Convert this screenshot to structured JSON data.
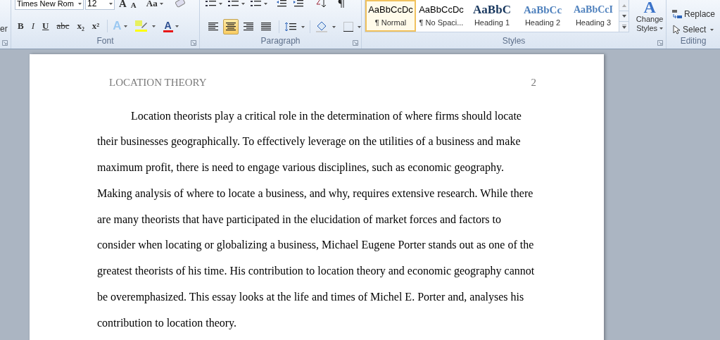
{
  "clipboard": {
    "label_fragment": "er"
  },
  "font": {
    "name": "Times New Rom",
    "size": "12",
    "format_buttons": [
      "B",
      "I",
      "U",
      "abc",
      "x₂",
      "x²"
    ],
    "case_button": "Aa",
    "grow_button": "A",
    "shrink_button": "A",
    "effects_button": "A",
    "color_button": "A",
    "label": "Font"
  },
  "paragraph": {
    "alignments": [
      {
        "kind": "left",
        "selected": false
      },
      {
        "kind": "center",
        "selected": true
      },
      {
        "kind": "right",
        "selected": false
      },
      {
        "kind": "justify",
        "selected": false
      }
    ],
    "label": "Paragraph"
  },
  "styles": {
    "items": [
      {
        "preview": "AaBbCcDc",
        "name": "¶ Normal",
        "kind": "normal",
        "selected": true
      },
      {
        "preview": "AaBbCcDc",
        "name": "¶ No Spaci...",
        "kind": "normal",
        "selected": false
      },
      {
        "preview": "AaBbC",
        "name": "Heading 1",
        "kind": "h1",
        "selected": false
      },
      {
        "preview": "AaBbCc",
        "name": "Heading 2",
        "kind": "h2",
        "selected": false
      },
      {
        "preview": "AaBbCcI",
        "name": "Heading 3",
        "kind": "h3",
        "selected": false
      }
    ],
    "change_styles": [
      "Change",
      "Styles"
    ],
    "change_styles_glyph": "A",
    "label": "Styles"
  },
  "editing": {
    "items": [
      "Replace",
      "Select"
    ],
    "label": "Editing"
  },
  "document": {
    "header": "LOCATION THEORY",
    "page_number": "2",
    "paragraph": "Location theorists play a critical role in the determination of where firms should locate their businesses geographically. To effectively leverage on the utilities of a business and make maximum profit, there is need to engage various disciplines, such as economic geography. Making analysis of where to locate a business, and why, requires extensive research. While there are many theorists that have participated in the elucidation of market forces and factors to consider when locating or globalizing a business, Michael Eugene Porter stands out as one of the greatest theorists of his time. His contribution to location theory and economic geography cannot be overemphasized. This essay looks at the life and times of Michel E. Porter and, analyses his contribution to location theory."
  }
}
